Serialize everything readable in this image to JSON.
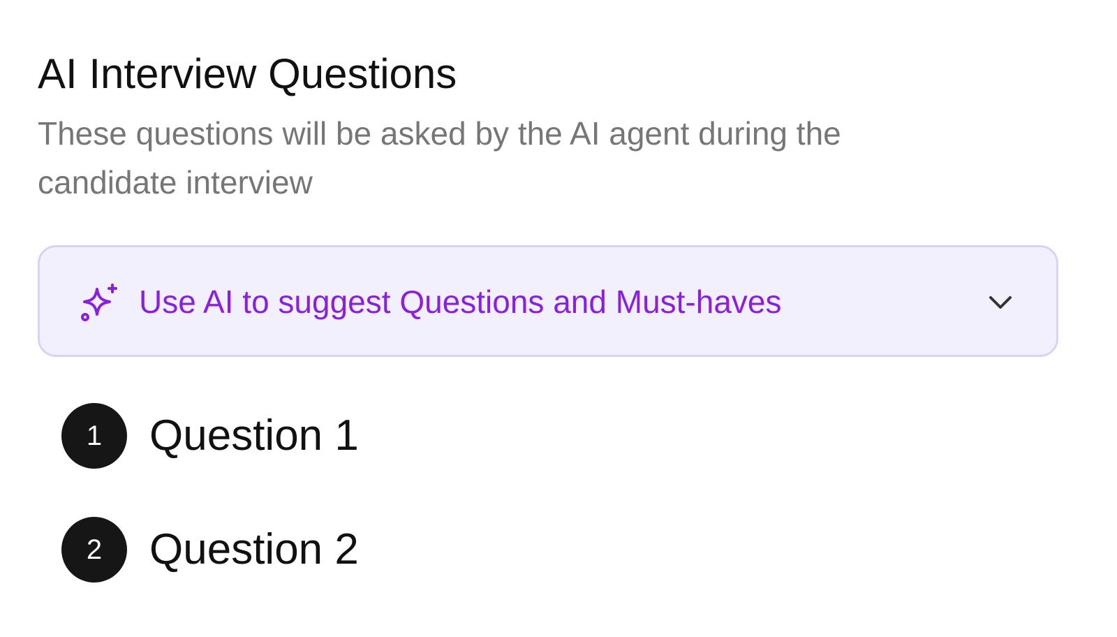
{
  "section": {
    "title": "AI Interview Questions",
    "subtitle": "These questions will be asked by the AI agent during the candidate interview"
  },
  "ai_suggest": {
    "label": "Use AI to suggest Questions and Must-haves",
    "icon": "sparkle-icon",
    "expand_icon": "chevron-down-icon",
    "accent_color": "#8a1fe0",
    "background_color": "#f3f0fd",
    "border_color": "#d9d1f6"
  },
  "questions": [
    {
      "number": "1",
      "label": "Question 1"
    },
    {
      "number": "2",
      "label": "Question 2"
    }
  ]
}
